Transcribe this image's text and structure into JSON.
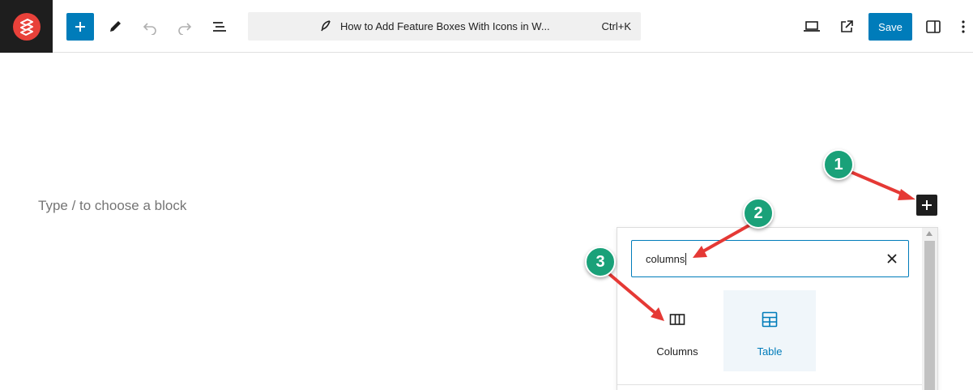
{
  "toolbar": {
    "command_title": "How to Add Feature Boxes With Icons in W...",
    "command_shortcut": "Ctrl+K",
    "save_label": "Save"
  },
  "editor": {
    "placeholder": "Type / to choose a block"
  },
  "inserter": {
    "search_value": "columns",
    "results": [
      {
        "label": "Columns",
        "icon": "columns-icon",
        "selected": false
      },
      {
        "label": "Table",
        "icon": "table-icon",
        "selected": true
      }
    ]
  },
  "annotations": {
    "step1": "1",
    "step2": "2",
    "step3": "3"
  },
  "colors": {
    "accent": "#007cba",
    "badge": "#1aa179",
    "arrow": "#e53935",
    "dark": "#1e1e1e"
  },
  "icons": [
    "logo-icon",
    "plus-icon",
    "pencil-icon",
    "undo-icon",
    "redo-icon",
    "list-view-icon",
    "feather-icon",
    "desktop-icon",
    "external-link-icon",
    "sidebar-icon",
    "more-vertical-icon",
    "close-icon",
    "columns-icon",
    "table-icon"
  ]
}
